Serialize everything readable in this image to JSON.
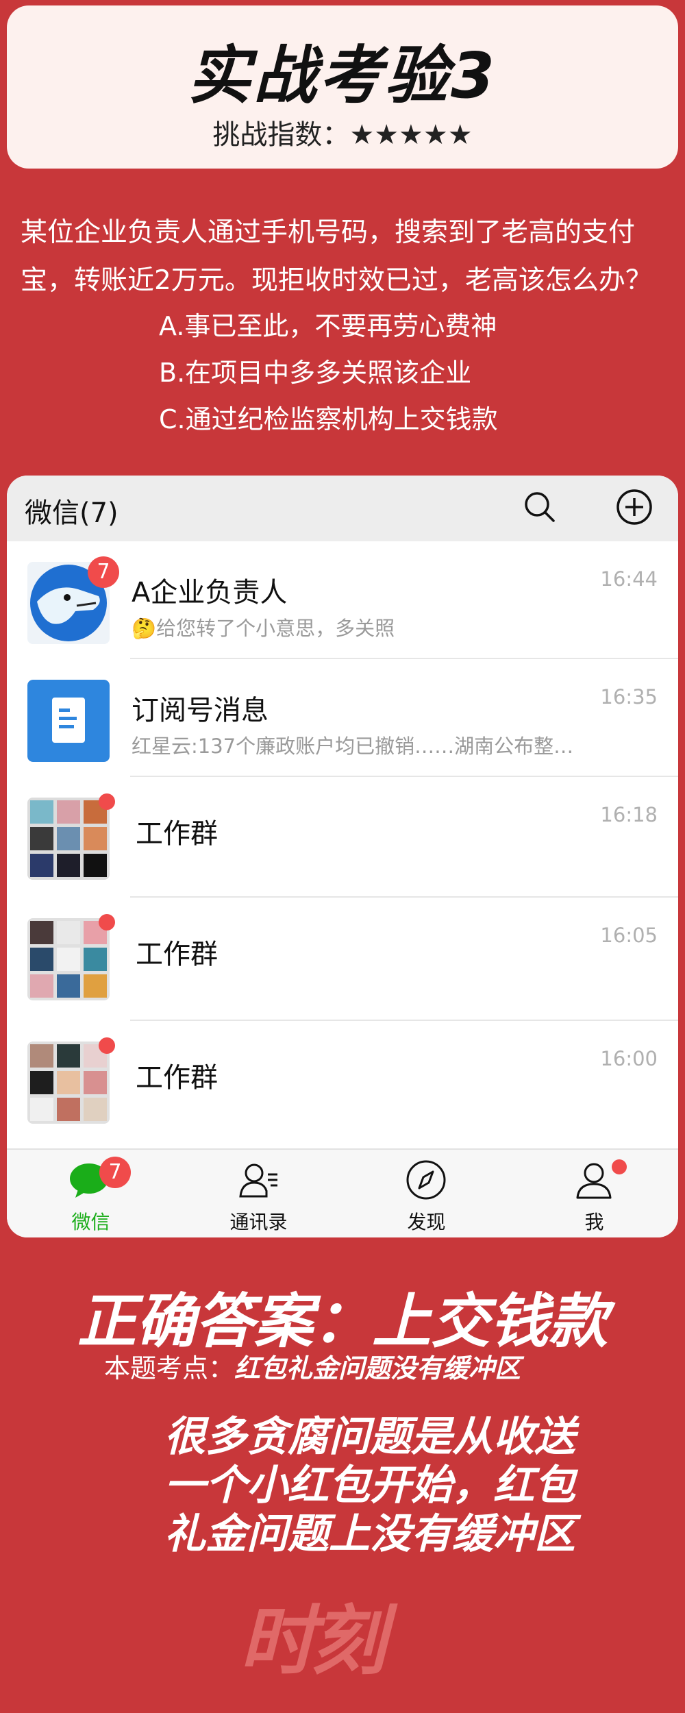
{
  "header": {
    "title": "实战考验3",
    "difficulty": "挑战指数：★★★★★"
  },
  "question": {
    "text": "某位企业负责人通过手机号码，搜索到了老高的支付宝，转账近2万元。现拒收时效已过，老高该怎么办？",
    "options": [
      "A.事已至此，不要再劳心费神",
      "B.在项目中多多关照该企业",
      "C.通过纪检监察机构上交钱款"
    ]
  },
  "wechat": {
    "title": "微信(7)",
    "icons": {
      "search": "search-icon",
      "add": "plus-circle-icon"
    },
    "chats": [
      {
        "name": "A企业负责人",
        "preview": "🤔给您转了个小意思，多关照",
        "time": "16:44",
        "badge": "7"
      },
      {
        "name": "订阅号消息",
        "preview": "红星云:137个廉政账户均已撤销……湖南公布整…",
        "time": "16:35"
      },
      {
        "name": "工作群",
        "preview": "",
        "time": "16:18"
      },
      {
        "name": "工作群",
        "preview": "",
        "time": "16:05"
      },
      {
        "name": "工作群",
        "preview": "",
        "time": "16:00"
      }
    ],
    "tabs": [
      {
        "label": "微信",
        "badge": "7",
        "icon": "chat-bubble-icon"
      },
      {
        "label": "通讯录",
        "icon": "contacts-icon"
      },
      {
        "label": "发现",
        "icon": "compass-icon"
      },
      {
        "label": "我",
        "icon": "person-icon"
      }
    ],
    "colors": {
      "accent_green": "#1aad19",
      "badge_red": "#f04b4b"
    }
  },
  "answer": {
    "text": "正确答案：上交钱款",
    "keypoint_label": "本题考点：",
    "keypoint_value": "红包礼金问题没有缓冲区",
    "commentary": [
      "很多贪腐问题是从收送",
      "一个小红包开始，红包",
      "礼金问题上没有缓冲区"
    ]
  },
  "watermark": "时刻",
  "colors": {
    "background": "#c8373a",
    "card": "#fdf1ee"
  }
}
